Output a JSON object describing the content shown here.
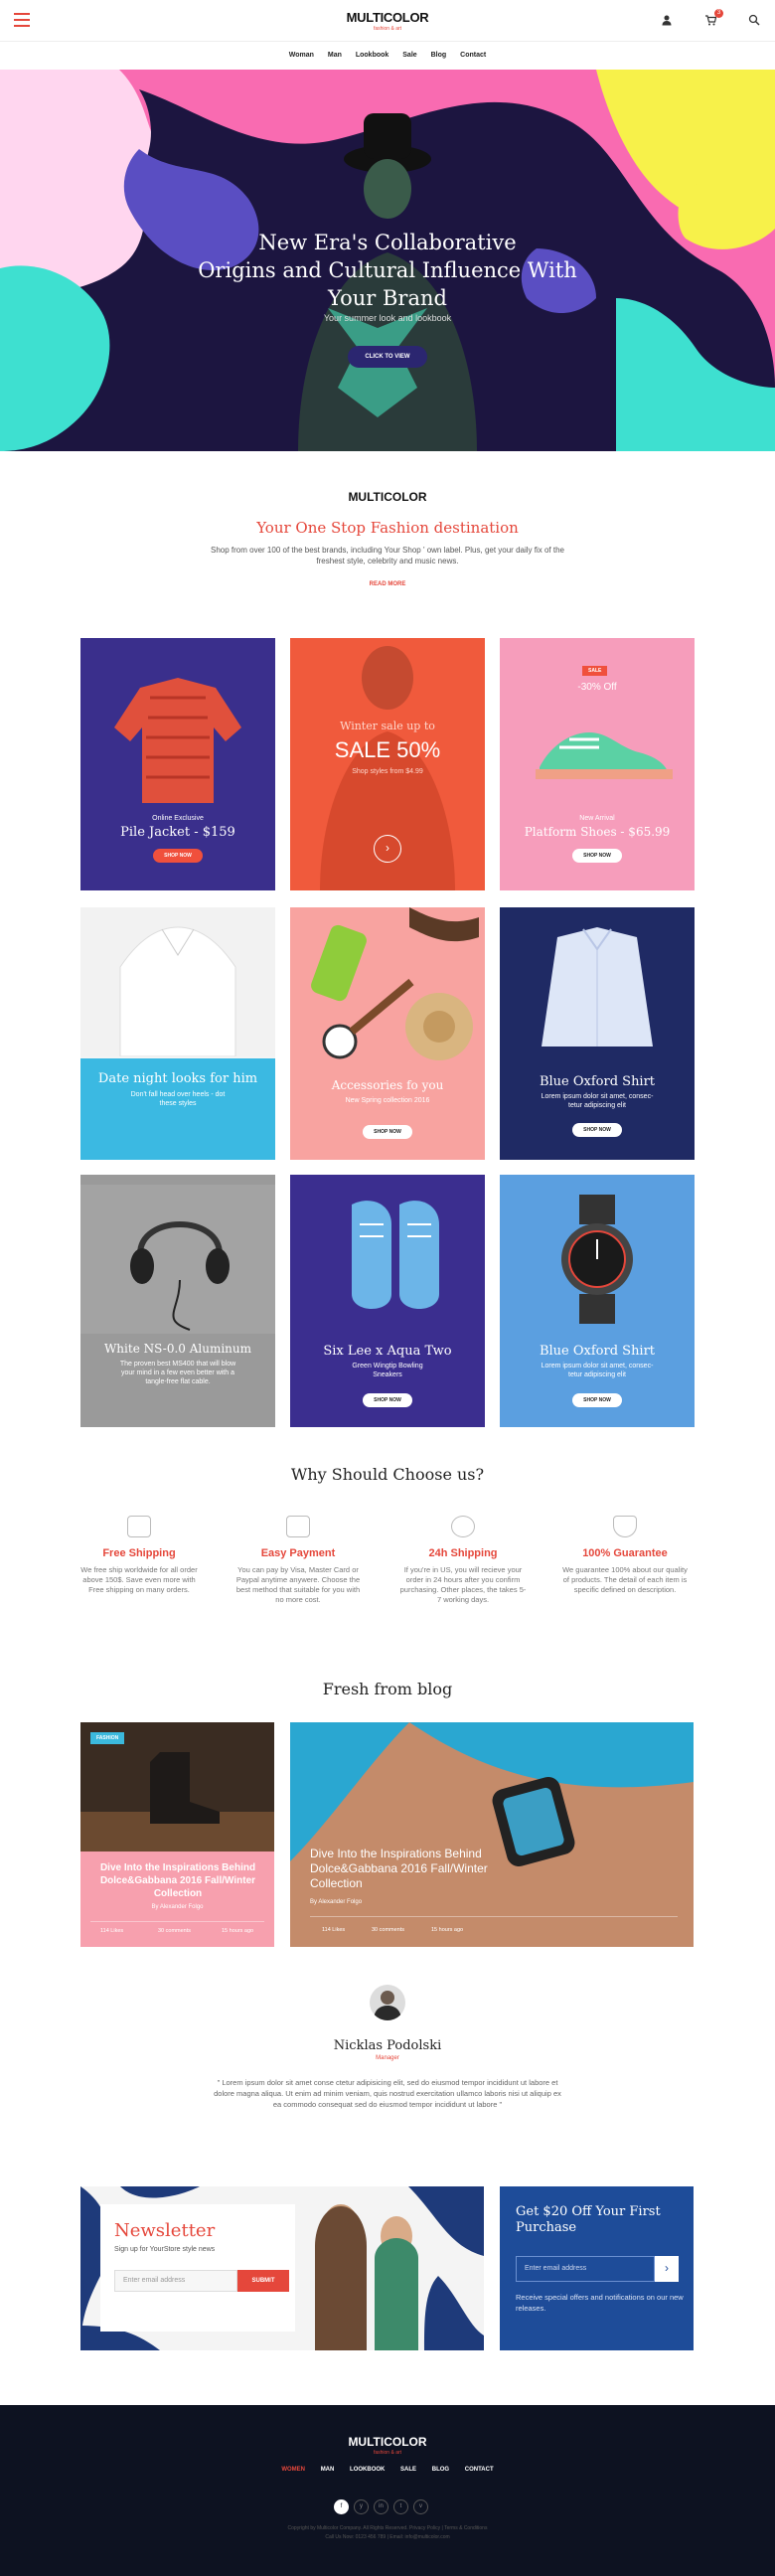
{
  "header": {
    "logo": "MULTICOLOR",
    "tagline": "fashion & art",
    "cart_count": "3"
  },
  "nav": {
    "items": [
      "Woman",
      "Man",
      "Lookbook",
      "Sale",
      "Blog",
      "Contact"
    ]
  },
  "hero": {
    "title_lines": [
      "New Era's Collaborative",
      "Origins and Cultural Influence With",
      "Your Brand"
    ],
    "subtitle": "Your summer look and lookbook",
    "button": "CLICK TO VIEW"
  },
  "intro": {
    "logo": "MULTICOLOR",
    "title": "Your One Stop Fashion destination",
    "text": "Shop from over 100 of the best brands, including Your Shop ' own label. Plus, get your daily fix of the freshest style, celebrity and music news.",
    "read_more": "READ MORE"
  },
  "cards": [
    {
      "label": "Online Exclusive",
      "title": "Pile Jacket - $159",
      "button": "SHOP NOW",
      "bg": "#3a2f8c"
    },
    {
      "label": "Winter sale up to",
      "title": "SALE 50%",
      "sub": "Shop styles from $4.99",
      "bg": "#f05a3c"
    },
    {
      "badge": "SALE",
      "pct": "-30% Off",
      "label": "New Arrival",
      "title": "Platform Shoes - $65.99",
      "button": "SHOP NOW",
      "bg": "#f69dbb"
    },
    {
      "title": "Date night looks for him",
      "text": "Don't fall head over heels - dot these styles",
      "bg": "#3bb9e2"
    },
    {
      "title": "Accessories fo you",
      "text": "New Spring collection 2016",
      "button": "SHOP NOW",
      "bg": "#f8a3a0"
    },
    {
      "title": "Blue Oxford Shirt",
      "text": "Lorem ipsum dolor sit amet, consec-tetur adipiscing elit",
      "button": "SHOP NOW",
      "bg": "#1f2a64"
    },
    {
      "title": "White NS-0.0 Aluminum",
      "text": "The proven best MS400 that will blow your mind in a few even better with a tangle-free flat cable.",
      "bg": "#9a9a9a"
    },
    {
      "title": "Six Lee x Aqua Two",
      "text": "Green Wingtip Bowling Sneakers",
      "button": "SHOP NOW",
      "bg": "#3b2e8f"
    },
    {
      "title": "Blue Oxford Shirt",
      "text": "Lorem ipsum dolor sit amet, consec-tetur adipiscing elit",
      "button": "SHOP NOW",
      "bg": "#5b9fe0"
    }
  ],
  "why": {
    "title": "Why Should Choose us?",
    "features": [
      {
        "icon": "truck-icon",
        "title": "Free Shipping",
        "text": "We free ship worldwide for all order above 150$. Save even more with Free shipping on many orders."
      },
      {
        "icon": "credit-card-icon",
        "title": "Easy Payment",
        "text": "You can pay by Visa, Master Card or Paypal anytime anywere. Choose the best method that suitable for you with no more cost."
      },
      {
        "icon": "clock-icon",
        "title": "24h Shipping",
        "text": "If you're in US, you will recieve your order in 24 hours after you confirm purchasing. Other places, the takes 5-7 working days."
      },
      {
        "icon": "shield-icon",
        "title": "100% Guarantee",
        "text": "We guarantee 100% about our quality of products. The detail of each item is specific defined on description."
      }
    ]
  },
  "blog": {
    "title": "Fresh from blog",
    "posts": [
      {
        "tag": "FASHION",
        "title": "Dive Into the Inspirations Behind Dolce&Gabbana 2016 Fall/Winter Collection",
        "by": "By Alexander Folgo",
        "likes": "114 Likes",
        "comments": "30 comments",
        "time": "15 hours ago"
      },
      {
        "title": "Dive Into the Inspirations Behind Dolce&Gabbana 2016 Fall/Winter Collection",
        "by": "By Alexander Folgo",
        "likes": "114 Likes",
        "comments": "30 comments",
        "time": "15 hours ago"
      }
    ]
  },
  "testimonial": {
    "name": "Nicklas Podolski",
    "role": "Manager",
    "quote": "\" Lorem ipsum dolor sit amet conse ctetur adipisicing elit, sed do eiusmod tempor incididunt ut labore et dolore magna aliqua. Ut enim ad minim veniam, quis nostrud exercitation ullamco laboris nisi ut aliquip ex ea commodo consequat sed do eiusmod tempor incididunt ut labore \""
  },
  "newsletter": {
    "title": "Newsletter",
    "sub": "Sign up for YourStore style news",
    "placeholder": "Enter email address",
    "button": "SUBMIT"
  },
  "gift": {
    "title": "Get $20 Off Your First Purchase",
    "placeholder": "Enter email address",
    "text": "Receive special offers and notifications on our new releases."
  },
  "footer": {
    "logo": "MULTICOLOR",
    "tagline": "fashion & art",
    "nav": [
      "WOMEN",
      "MAN",
      "LOOKBOOK",
      "SALE",
      "BLOG",
      "CONTACT"
    ],
    "social": [
      "f",
      "y",
      "in",
      "t",
      "v"
    ],
    "copy_lines": [
      "Copyright by Multicolor Company. All Rights Reserved. Privacy Policy | Terms & Conditions",
      "Call Us Now: 0123 456 789 | Email: info@multicolor.com"
    ]
  }
}
